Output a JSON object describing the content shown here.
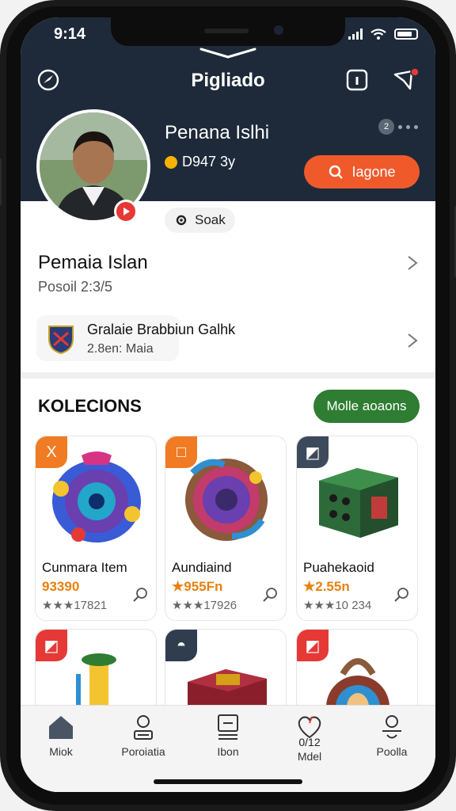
{
  "status": {
    "time": "9:14"
  },
  "header": {
    "title": "Pigliado"
  },
  "profile": {
    "name": "Penana Islhi",
    "stat": "D947 3y",
    "badge_count": "2",
    "action_label": "Iagone",
    "chip_label": "Soak"
  },
  "section_profile": {
    "title": "Pemaia Islan",
    "subtitle": "Posoil 2:3/5"
  },
  "linked_item": {
    "title": "Gralaie Brabbiun Galhk",
    "subtitle": "2.8en: Maia"
  },
  "collections": {
    "title": "KOLECIONS",
    "more_label": "Molle aoaons",
    "items": [
      {
        "name": "Cunmara Item",
        "price": "93390",
        "rating": "★★★17821",
        "tag": "X",
        "tag_color": "#f07b22"
      },
      {
        "name": "Aundiaind",
        "price": "★955Fn",
        "rating": "★★★17926",
        "tag": "□",
        "tag_color": "#f07b22"
      },
      {
        "name": "Puahekaoid",
        "price": "★2.55n",
        "rating": "★★★10 234",
        "tag": "◩",
        "tag_color": "#3d4a5c"
      },
      {
        "name": "",
        "price": "",
        "rating": "",
        "tag": "◩",
        "tag_color": "#e53935"
      },
      {
        "name": "",
        "price": "",
        "rating": "",
        "tag": "◓",
        "tag_color": "#2f3d4f"
      },
      {
        "name": "",
        "price": "",
        "rating": "",
        "tag": "◩",
        "tag_color": "#e53935"
      }
    ]
  },
  "nav": {
    "items": [
      {
        "label": "Miok",
        "icon": "home-icon"
      },
      {
        "label": "Poroiatia",
        "icon": "user-card-icon"
      },
      {
        "label": "Ibon",
        "icon": "list-icon"
      },
      {
        "label": "Mdel",
        "icon": "heart-icon",
        "badge": "0/12"
      },
      {
        "label": "Poolla",
        "icon": "profile-icon"
      }
    ]
  }
}
